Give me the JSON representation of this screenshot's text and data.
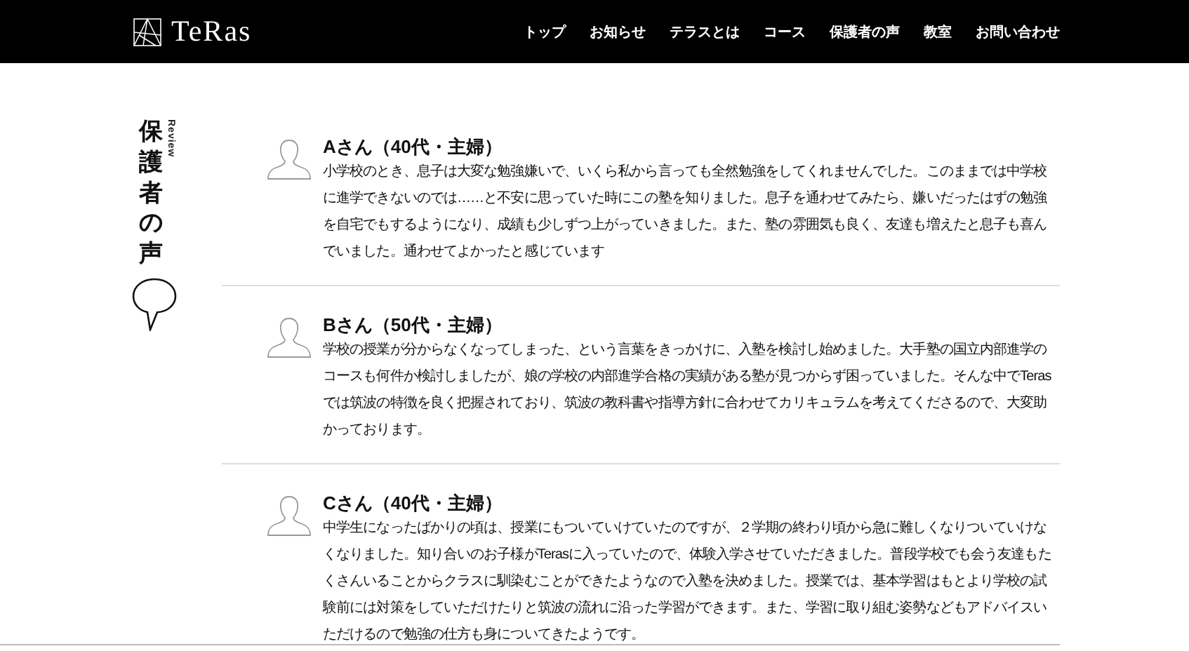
{
  "header": {
    "logo": "TeRas",
    "nav": [
      {
        "label": "トップ"
      },
      {
        "label": "お知らせ"
      },
      {
        "label": "テラスとは"
      },
      {
        "label": "コース"
      },
      {
        "label": "保護者の声"
      },
      {
        "label": "教室"
      },
      {
        "label": "お問い合わせ"
      }
    ]
  },
  "sidebar": {
    "title": "保護者の声",
    "subtitle": "Review"
  },
  "reviews": [
    {
      "name": "Aさん（40代・主婦）",
      "text": "小学校のとき、息子は大変な勉強嫌いで、いくら私から言っても全然勉強をしてくれませんでした。このままでは中学校に進学できないのでは……と不安に思っていた時にこの塾を知りました。息子を通わせてみたら、嫌いだったはずの勉強を自宅でもするようになり、成績も少しずつ上がっていきました。また、塾の雰囲気も良く、友達も増えたと息子も喜んでいました。通わせてよかったと感じています"
    },
    {
      "name": "Bさん（50代・主婦）",
      "text": "学校の授業が分からなくなってしまった、という言葉をきっかけに、入塾を検討し始めました。大手塾の国立内部進学のコースも何件か検討しましたが、娘の学校の内部進学合格の実績がある塾が見つからず困っていました。そんな中でTerasでは筑波の特徴を良く把握されており、筑波の教科書や指導方針に合わせてカリキュラムを考えてくださるので、大変助かっております。"
    },
    {
      "name": "Cさん（40代・主婦）",
      "text": "中学生になったばかりの頃は、授業にもついていけていたのですが、２学期の終わり頃から急に難しくなりついていけなくなりました。知り合いのお子様がTerasに入っていたので、体験入学させていただきました。普段学校でも会う友達もたくさんいることからクラスに馴染むことができたようなので入塾を決めました。授業では、基本学習はもとより学校の試験前には対策をしていただけたりと筑波の流れに沿った学習ができます。また、学習に取り組む姿勢などもアドバイスいただけるので勉強の仕方も身についてきたようです。"
    }
  ]
}
